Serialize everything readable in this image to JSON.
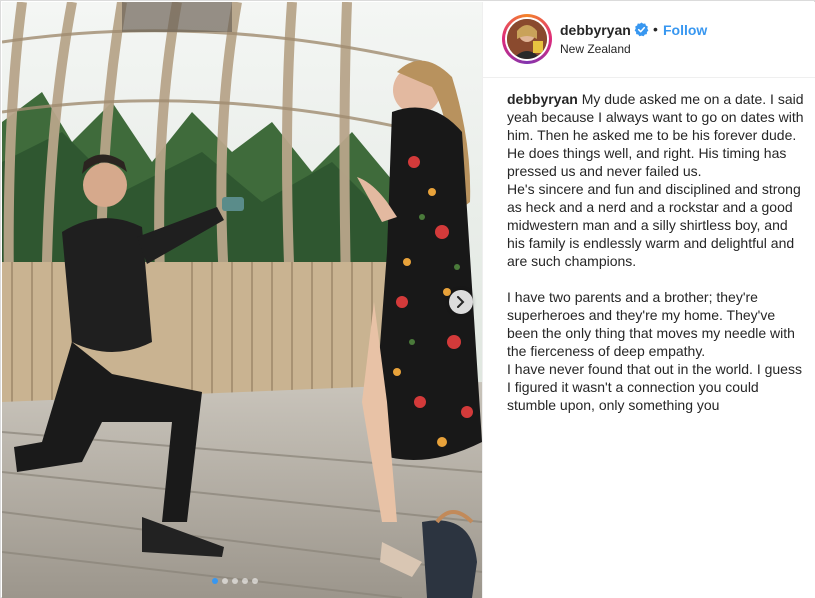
{
  "post": {
    "username": "debbyryan",
    "follow_label": "Follow",
    "separator": "•",
    "location": "New Zealand",
    "verified_icon": "verified-badge-icon",
    "caption_user": "debbyryan",
    "caption_lines": [
      "My dude asked me on a date. I said yeah because I always want to go on dates with him. Then he asked me to be his forever dude.",
      "He does things well, and right. His timing has pressed us and never failed us.",
      "He's sincere and fun and disciplined and strong as heck and a nerd and a rockstar and a good midwestern man and a silly shirtless boy, and his family is endlessly warm and delightful and are such champions.",
      "",
      "I have two parents and a brother; they're superheroes and they're my home. They've been the only thing that moves my needle with the fierceness of deep empathy.",
      "I have never found that out in the world. I guess I figured it wasn't a connection you could stumble upon, only something you"
    ],
    "carousel": {
      "slide_count": 5,
      "active_index": 0
    }
  },
  "colors": {
    "accent": "#3897f0",
    "text": "#262626",
    "border": "#efefef"
  }
}
